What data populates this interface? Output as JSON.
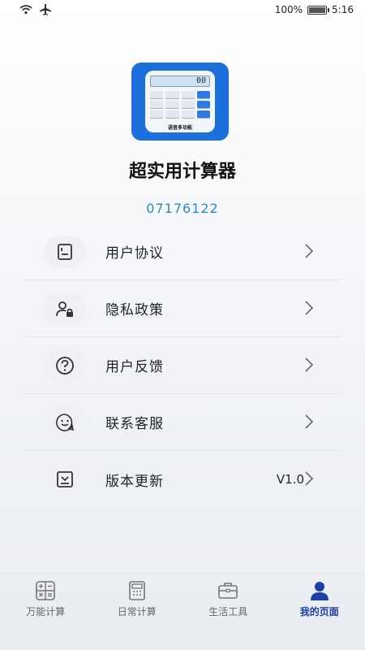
{
  "status_bar": {
    "battery_text": "100%",
    "time": "5:16"
  },
  "app": {
    "name": "超实用计算器",
    "code": "07176122",
    "icon_screen": "00",
    "icon_caption": "语音多功能"
  },
  "menu": {
    "items": [
      {
        "label": "用户协议",
        "icon": "document-icon"
      },
      {
        "label": "隐私政策",
        "icon": "user-lock-icon"
      },
      {
        "label": "用户反馈",
        "icon": "question-icon"
      },
      {
        "label": "联系客服",
        "icon": "chat-smile-icon"
      },
      {
        "label": "版本更新",
        "icon": "download-box-icon",
        "value": "V1.0"
      }
    ]
  },
  "tabbar": {
    "tabs": [
      {
        "label": "万能计算",
        "icon": "calculator-grid-icon",
        "active": false
      },
      {
        "label": "日常计算",
        "icon": "calculator-icon",
        "active": false
      },
      {
        "label": "生活工具",
        "icon": "briefcase-icon",
        "active": false
      },
      {
        "label": "我的页面",
        "icon": "person-icon",
        "active": true
      }
    ]
  },
  "colors": {
    "accent": "#2b8ac4",
    "tab_active": "#1a3fa8",
    "icon_bg": "#1d6fdc"
  }
}
